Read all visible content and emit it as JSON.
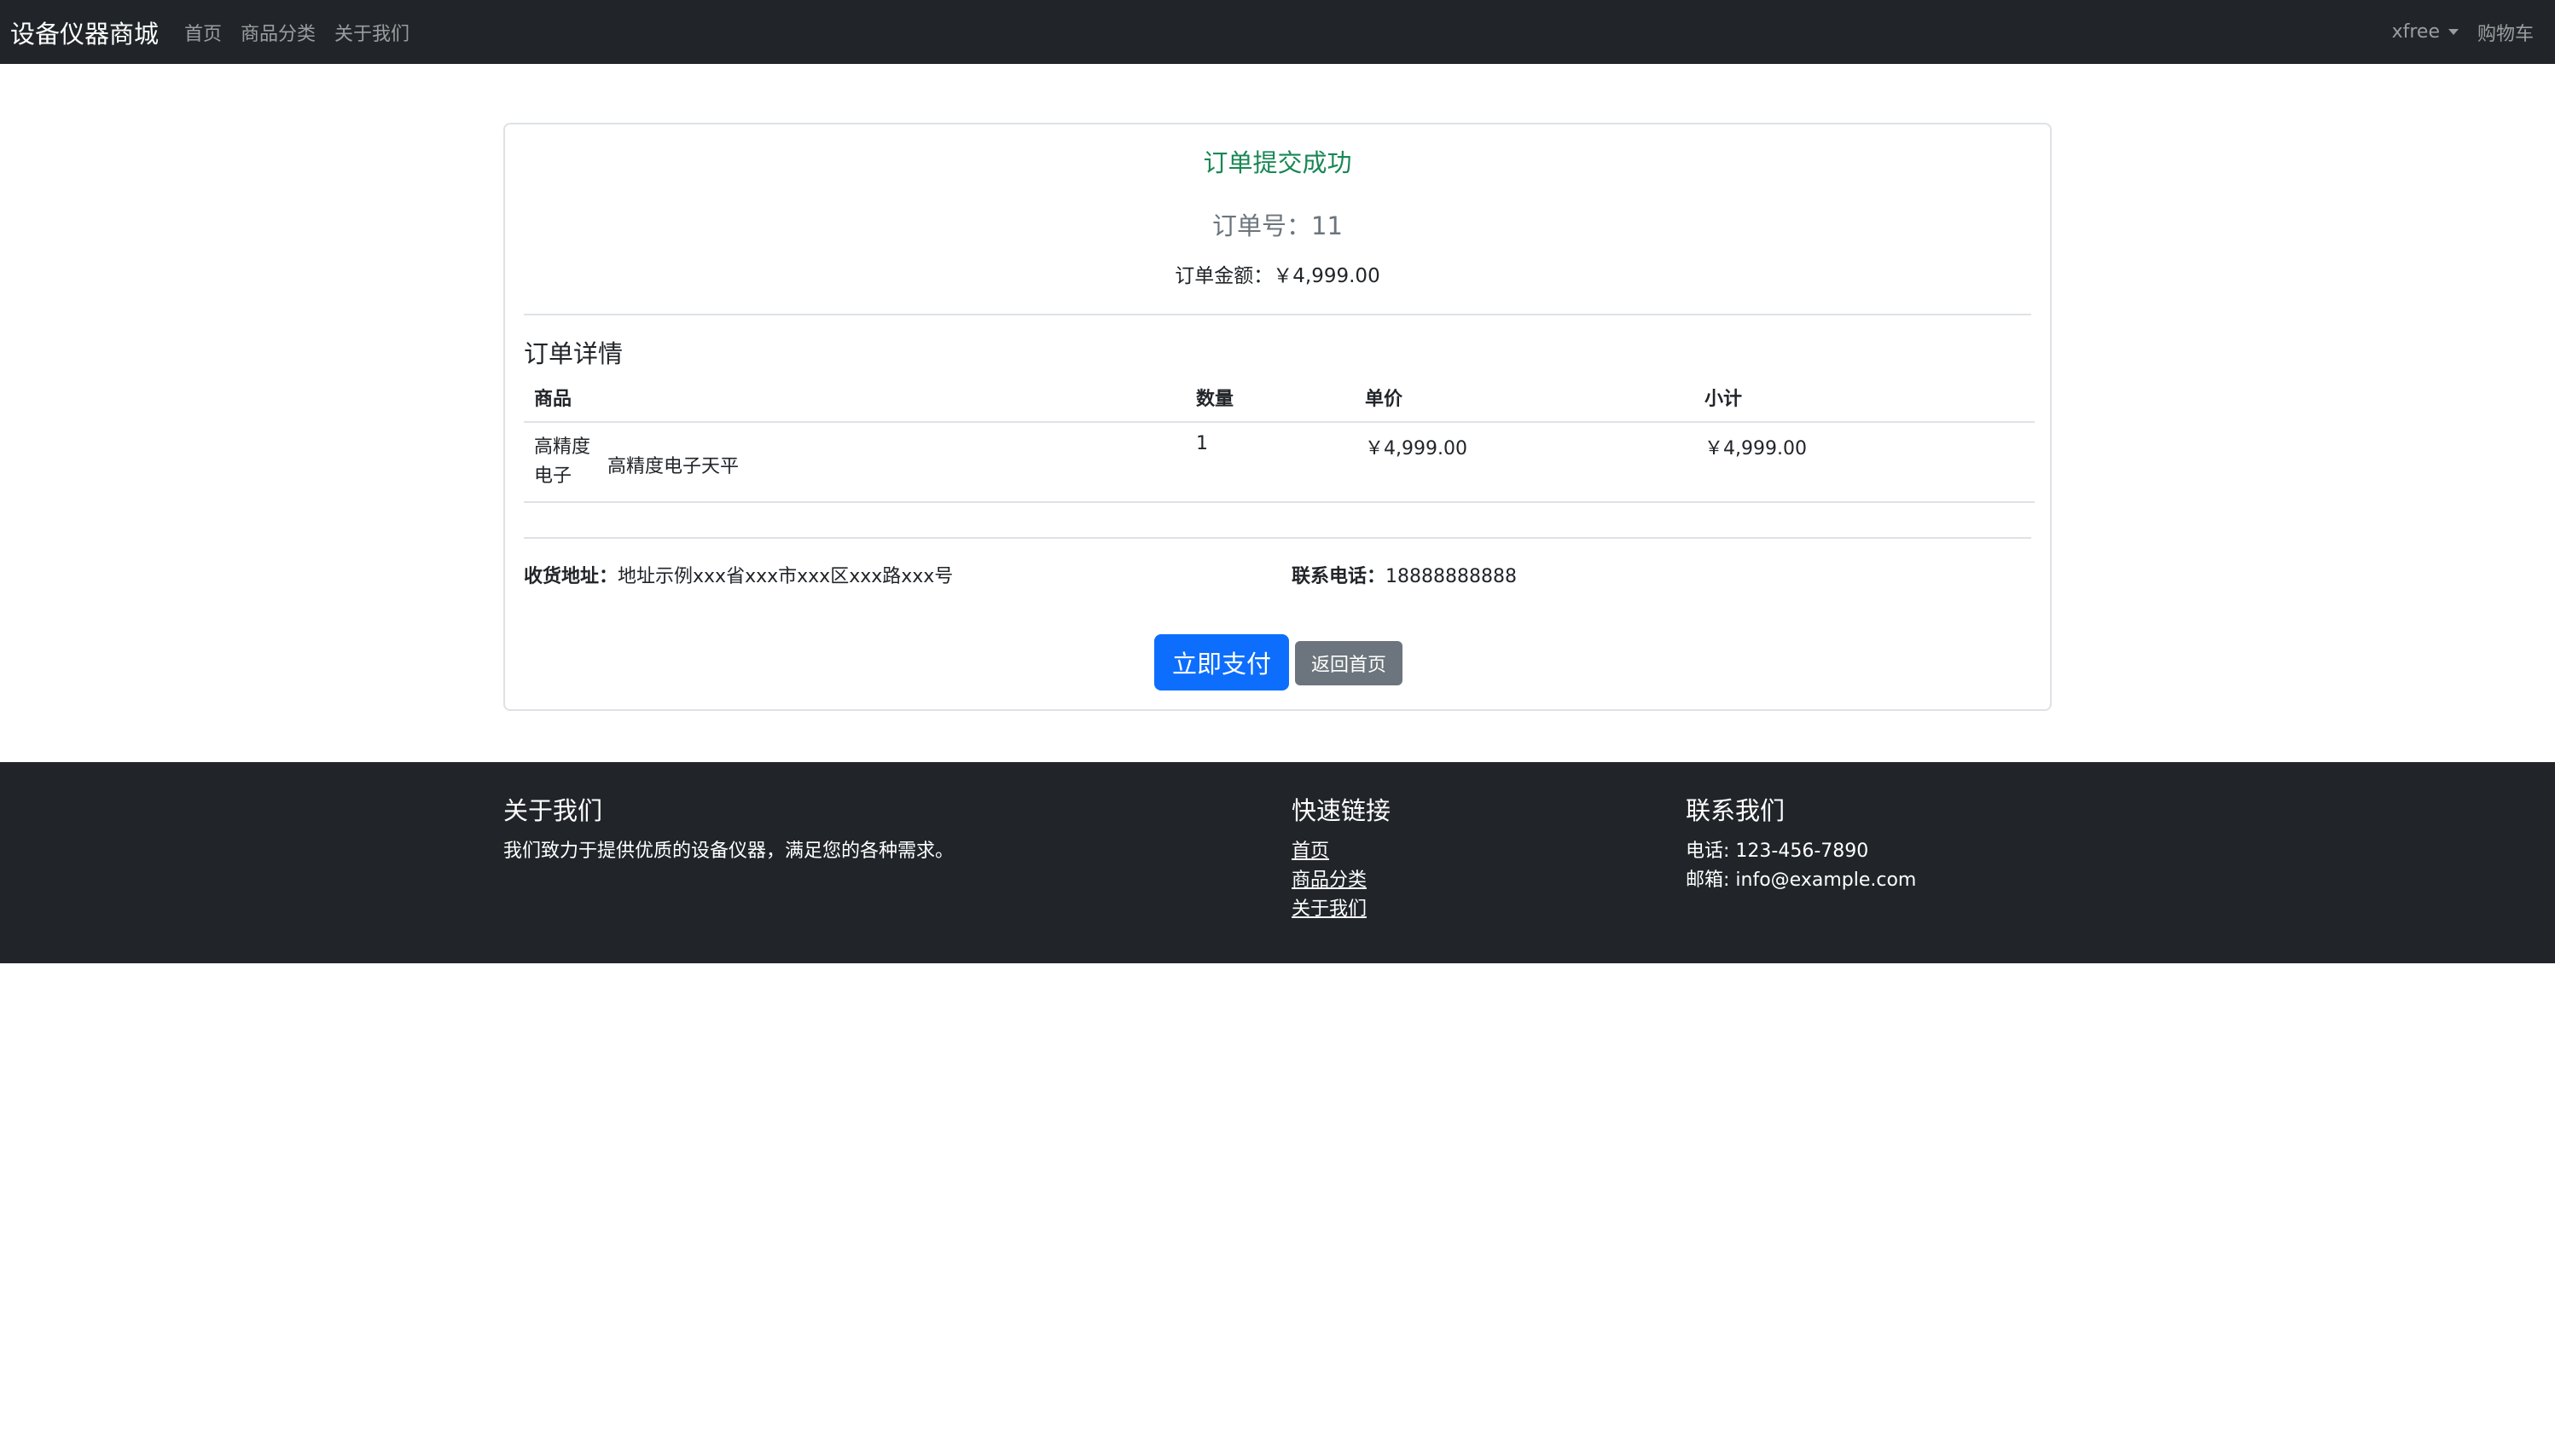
{
  "navbar": {
    "brand": "设备仪器商城",
    "links": [
      "首页",
      "商品分类",
      "关于我们"
    ],
    "user": "xfree",
    "cart": "购物车"
  },
  "order": {
    "success_title": "订单提交成功",
    "order_no_label": "订单号：",
    "order_no": "11",
    "amount_label": "订单金额：",
    "amount": "￥4,999.00",
    "details_title": "订单详情",
    "table": {
      "headers": [
        "商品",
        "数量",
        "单价",
        "小计"
      ],
      "rows": [
        {
          "image_alt": "高精度电子",
          "name": "高精度电子天平",
          "qty": "1",
          "price": "￥4,999.00",
          "subtotal": "￥4,999.00"
        }
      ]
    },
    "address_label": "收货地址：",
    "address": "地址示例xxx省xxx市xxx区xxx路xxx号",
    "phone_label": "联系电话：",
    "phone": "18888888888",
    "pay_button": "立即支付",
    "home_button": "返回首页"
  },
  "footer": {
    "about": {
      "title": "关于我们",
      "text": "我们致力于提供优质的设备仪器，满足您的各种需求。"
    },
    "links": {
      "title": "快速链接",
      "items": [
        "首页",
        "商品分类",
        "关于我们"
      ]
    },
    "contact": {
      "title": "联系我们",
      "phone": "电话: 123-456-7890",
      "email": "邮箱: info@example.com"
    }
  },
  "colors": {
    "navbar_bg": "#212529",
    "success": "#198754",
    "primary": "#0d6efd",
    "secondary": "#6c757d"
  }
}
